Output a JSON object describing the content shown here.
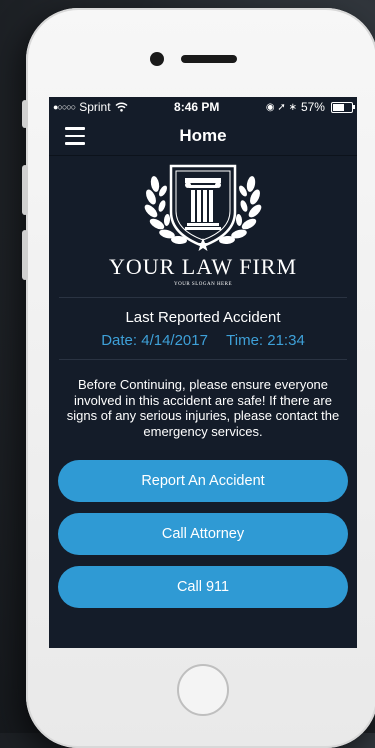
{
  "status_bar": {
    "signal_dots": "●○○○○",
    "carrier": "Sprint",
    "wifi_icon": "wifi-icon",
    "time": "8:46 PM",
    "right_icons": "◉ ➚ ∗",
    "battery_percent": "57%",
    "battery_level": 0.57
  },
  "header": {
    "title": "Home",
    "menu_icon": "hamburger-menu-icon"
  },
  "logo": {
    "firm_name": "YOUR LAW FIRM",
    "slogan": "YOUR SLOGAN HERE"
  },
  "accident": {
    "heading": "Last Reported Accident",
    "date_text": "Date: 4/14/2017",
    "time_text": "Time: 21:34",
    "accent_color": "#3ea0d8"
  },
  "notice": "Before Continuing, please ensure everyone involved in this accident are safe! If there are signs of any serious injuries, please contact the emergency services.",
  "buttons": {
    "report": "Report An Accident",
    "attorney": "Call Attorney",
    "emergency": "Call 911",
    "color": "#2f9ad4"
  }
}
